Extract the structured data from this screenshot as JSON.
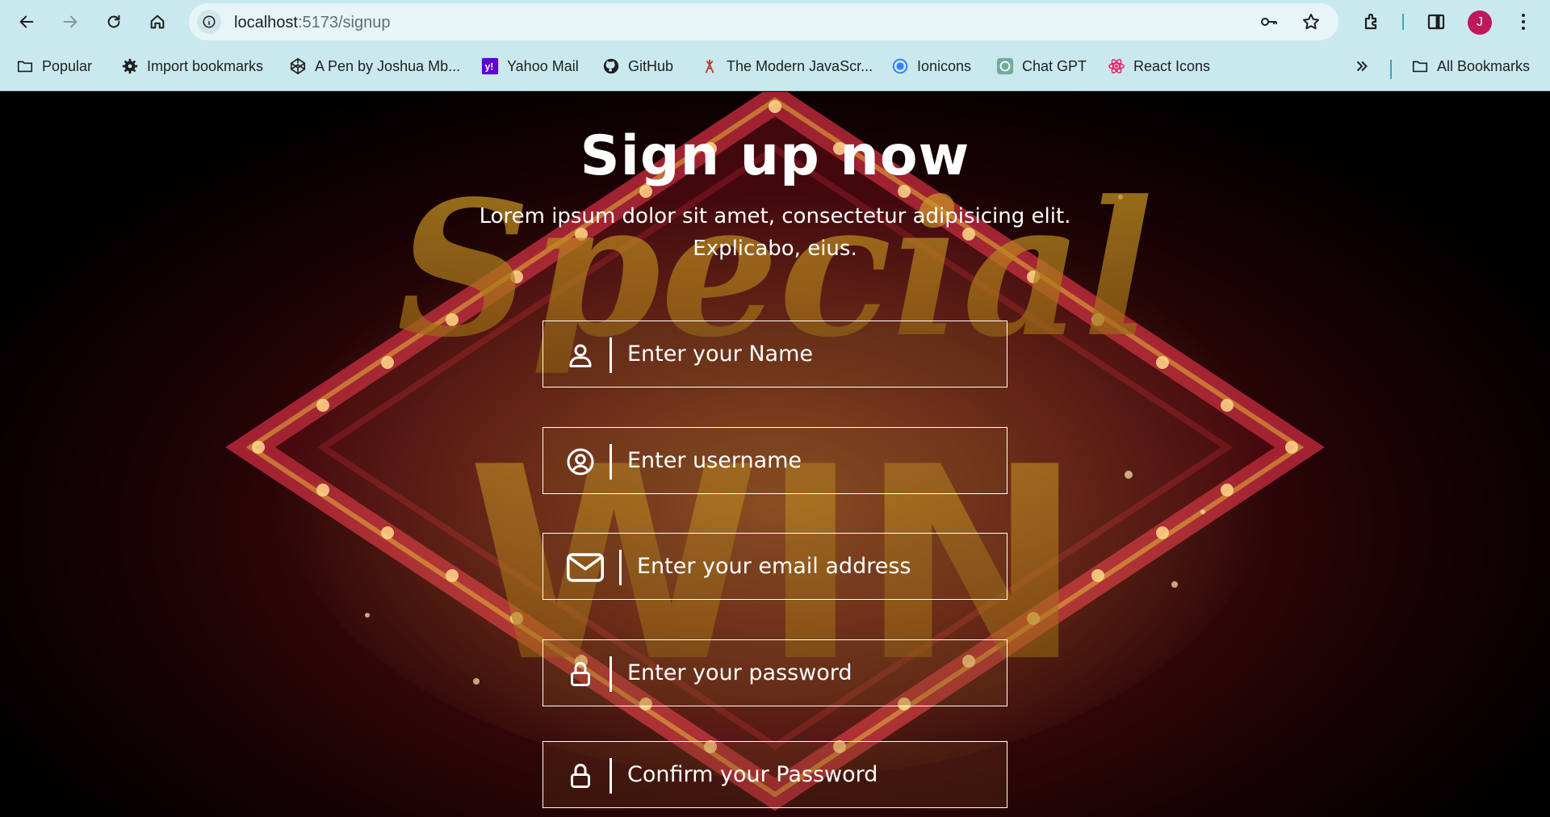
{
  "browser": {
    "url_host": "localhost",
    "url_path": ":5173/signup",
    "avatar_letter": "J",
    "bookmarks": [
      {
        "label": "Popular",
        "icon": "folder-icon"
      },
      {
        "label": "Import bookmarks",
        "icon": "gear-icon"
      },
      {
        "label": "A Pen by Joshua Mb...",
        "icon": "codepen-icon"
      },
      {
        "label": "Yahoo Mail",
        "icon": "yahoo-icon"
      },
      {
        "label": "GitHub",
        "icon": "github-icon"
      },
      {
        "label": "The Modern JavaScr...",
        "icon": "javascript-info-icon"
      },
      {
        "label": "Ionicons",
        "icon": "ionicons-icon"
      },
      {
        "label": "Chat GPT",
        "icon": "openai-icon"
      },
      {
        "label": "React Icons",
        "icon": "react-icon"
      }
    ],
    "all_bookmarks": "All Bookmarks"
  },
  "signup": {
    "title": "Sign up now",
    "subtitle_line1": "Lorem ipsum dolor sit amet, consectetur adipisicing elit.",
    "subtitle_line2": "Explicabo, eius.",
    "fields": {
      "name": {
        "placeholder": "Enter your Name",
        "icon": "person-icon"
      },
      "username": {
        "placeholder": "Enter username",
        "icon": "user-circle-icon"
      },
      "email": {
        "placeholder": "Enter your email address",
        "icon": "mail-icon"
      },
      "password": {
        "placeholder": "Enter your password",
        "icon": "lock-icon"
      },
      "confirm": {
        "placeholder": "Confirm your Password",
        "icon": "lock-icon"
      }
    }
  },
  "background": {
    "word_top": "Special",
    "word_bottom": "WIN"
  },
  "colors": {
    "chrome": "#c9e9ee",
    "avatar": "#c0185a",
    "accent": "#3fa7b0"
  }
}
